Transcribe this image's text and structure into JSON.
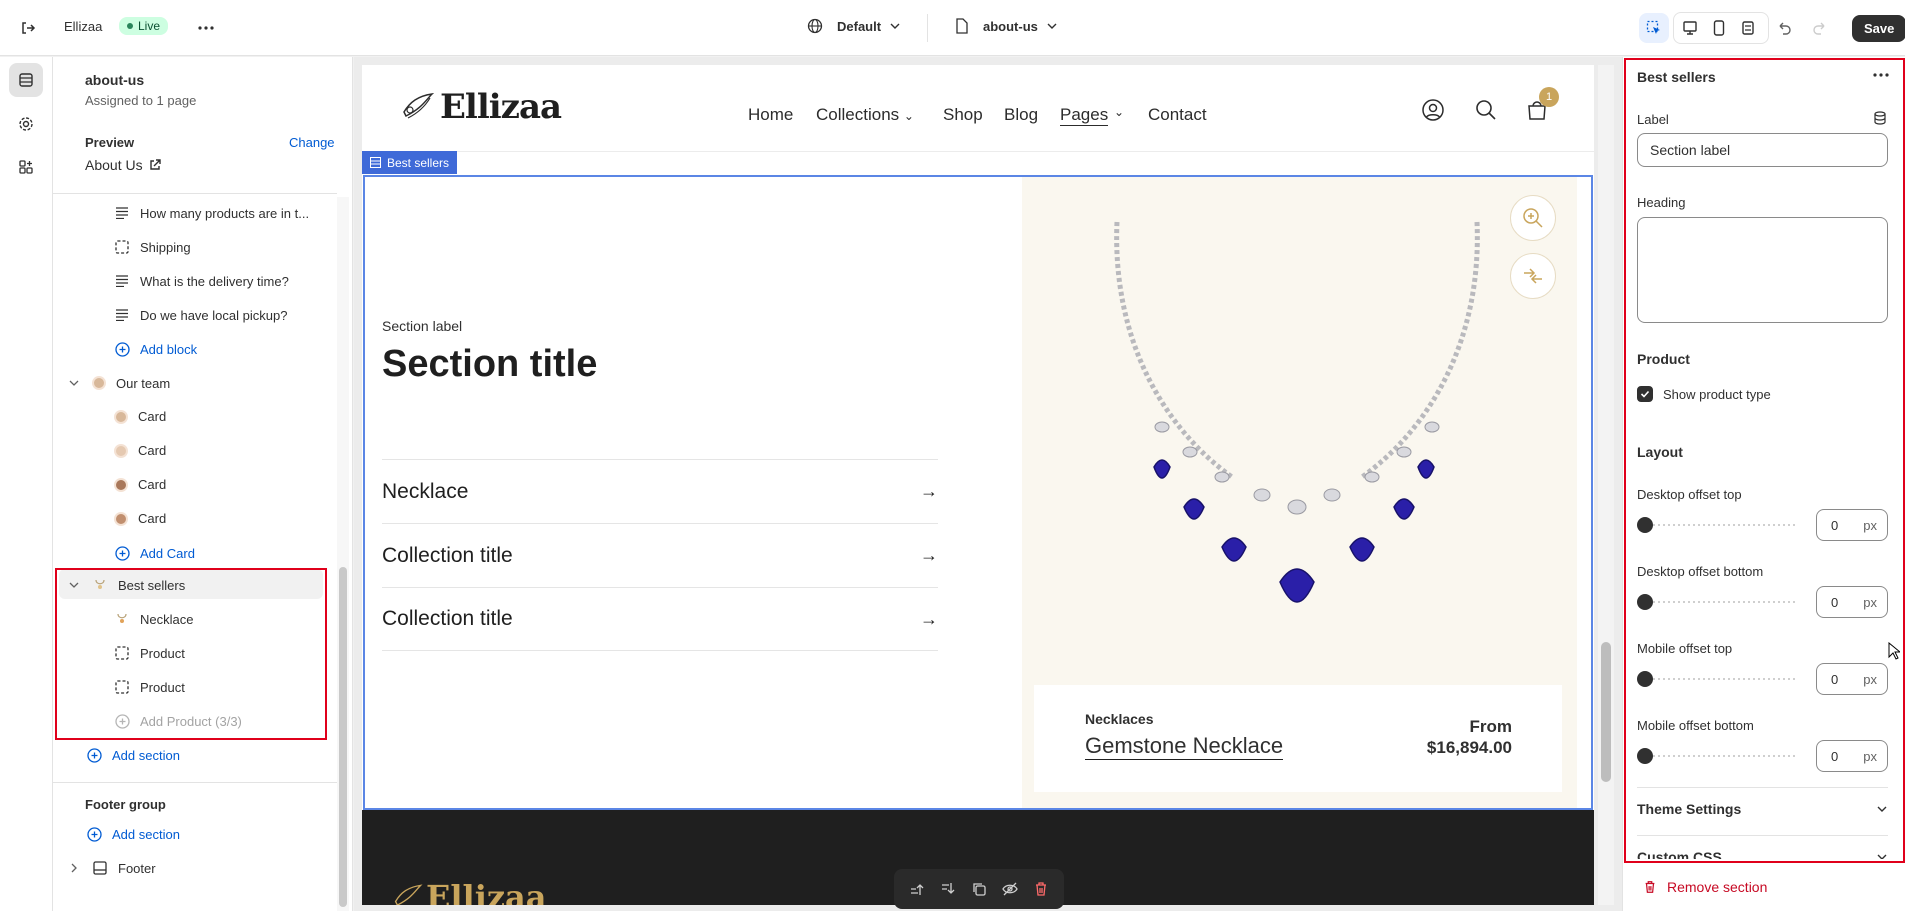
{
  "topbar": {
    "store_name": "Ellizaa",
    "status_badge": "Live",
    "theme_select": "Default",
    "page_select": "about-us",
    "save_label": "Save"
  },
  "sidebar": {
    "template_name": "about-us",
    "assigned_text": "Assigned to 1 page",
    "preview_label": "Preview",
    "change_label": "Change",
    "preview_page": "About Us",
    "rows": [
      "How many products are in t...",
      "Shipping",
      "What is the delivery time?",
      "Do we have local pickup?",
      "Add block",
      "Our team",
      "Card",
      "Card",
      "Card",
      "Card",
      "Add Card",
      "Best sellers",
      "Necklace",
      "Product",
      "Product",
      "Add Product (3/3)",
      "Add section"
    ],
    "footer_group_label": "Footer group",
    "footer_add_section": "Add section",
    "footer_item": "Footer"
  },
  "preview": {
    "logo": "Ellizaa",
    "nav": [
      "Home",
      "Collections",
      "Shop",
      "Blog",
      "Pages",
      "Contact"
    ],
    "cart_count": "1",
    "section_tag": "Best sellers",
    "section_label": "Section label",
    "section_title": "Section title",
    "collections": [
      "Necklace",
      "Collection title",
      "Collection title"
    ],
    "product_type": "Necklaces",
    "product_name": "Gemstone Necklace",
    "price_from": "From",
    "price": "$16,894.00",
    "footer_logo": "Ellizaa"
  },
  "panel": {
    "title": "Best sellers",
    "label_field_label": "Label",
    "label_value": "Section label",
    "heading_label": "Heading",
    "heading_value": "",
    "product_heading": "Product",
    "show_product_type": "Show product type",
    "layout_heading": "Layout",
    "offsets": [
      {
        "label": "Desktop offset top",
        "value": "0",
        "unit": "px"
      },
      {
        "label": "Desktop offset bottom",
        "value": "0",
        "unit": "px"
      },
      {
        "label": "Mobile offset top",
        "value": "0",
        "unit": "px"
      },
      {
        "label": "Mobile offset bottom",
        "value": "0",
        "unit": "px"
      }
    ],
    "theme_settings": "Theme Settings",
    "custom_css": "Custom CSS",
    "remove_section": "Remove section"
  },
  "colors": {
    "accent_blue": "#005bd3",
    "selection_blue": "#3f6ad8",
    "highlight_red": "#e0001b",
    "gem_blue": "#2a1fa8",
    "badge_gold": "#c9a55c"
  }
}
